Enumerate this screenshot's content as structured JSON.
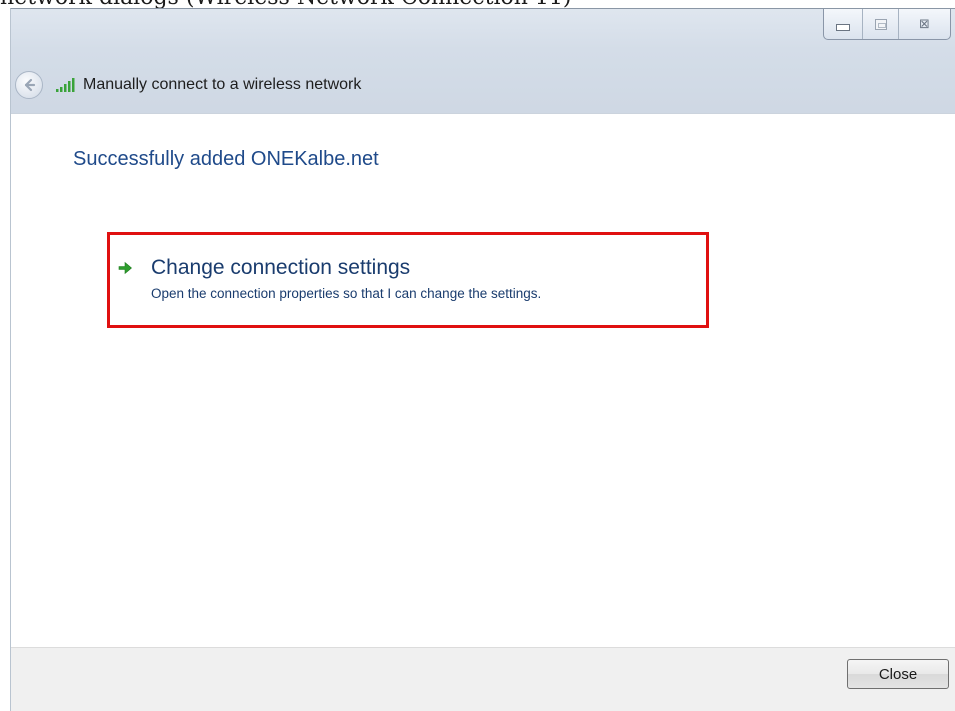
{
  "window": {
    "clipped_caption": "network dialogs (Wireless Network Connection 11)",
    "caption_buttons": {
      "minimize": "minimize-icon",
      "maximize": "maximize-icon",
      "close_glyph": "⊠"
    }
  },
  "nav": {
    "title": "Manually connect to a wireless network",
    "back_icon": "back-arrow-icon",
    "network_icon": "wireless-signal-icon"
  },
  "content": {
    "success_title": "Successfully added ONEKalbe.net",
    "link": {
      "title": "Change connection settings",
      "description": "Open the connection properties so that I can change the settings.",
      "icon": "green-arrow-icon"
    }
  },
  "footer": {
    "close_label": "Close"
  },
  "colors": {
    "title_blue": "#1f4a8a",
    "highlight_red": "#e01010",
    "arrow_green": "#2e9e2e"
  }
}
